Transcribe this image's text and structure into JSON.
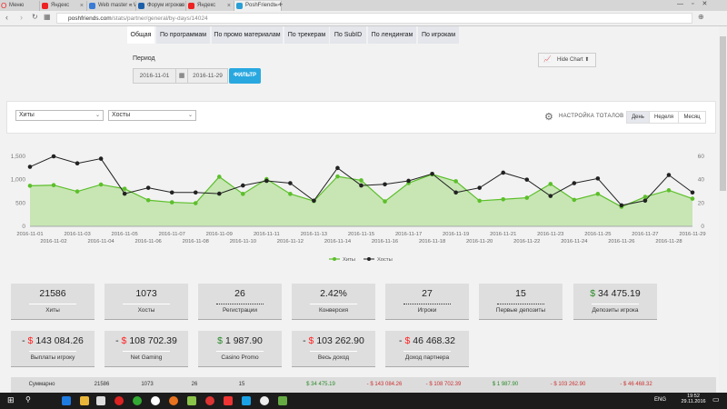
{
  "browser": {
    "menu": "Меню",
    "tabs": [
      {
        "title": "Яндекс",
        "color": "#e22"
      },
      {
        "title": "Web master « Web master",
        "color": "#3a7bd5"
      },
      {
        "title": "Форум игроков онлайн-к",
        "color": "#1c5fa8"
      },
      {
        "title": "Яндекс",
        "color": "#e22"
      },
      {
        "title": "PoshFriends - Партнерск",
        "color": "#2a9fd6"
      }
    ],
    "url_domain": "poshfriends.com",
    "url_path": "/stats/partner/general/by-days/14024"
  },
  "nav": {
    "tabs": [
      "Общая",
      "По программам",
      "По промо материалам",
      "По трекерам",
      "По SubID",
      "По лендингам",
      "По игрокам"
    ],
    "active": 0
  },
  "period": {
    "label": "Период",
    "from": "2016-11-01",
    "to": "2016-11-29",
    "filter": "ФИЛЬТР"
  },
  "hide_chart": "Hide Chart",
  "selects": {
    "left": "Хиты",
    "right": "Хосты"
  },
  "totals_settings": "НАСТРОЙКА ТОТАЛОВ",
  "periods": [
    "День",
    "Неделя",
    "Месяц"
  ],
  "chart_data": {
    "type": "line",
    "x": [
      "2016-11-01",
      "2016-11-02",
      "2016-11-03",
      "2016-11-04",
      "2016-11-05",
      "2016-11-06",
      "2016-11-07",
      "2016-11-08",
      "2016-11-09",
      "2016-11-10",
      "2016-11-11",
      "2016-11-12",
      "2016-11-13",
      "2016-11-14",
      "2016-11-15",
      "2016-11-16",
      "2016-11-17",
      "2016-11-18",
      "2016-11-19",
      "2016-11-20",
      "2016-11-21",
      "2016-11-22",
      "2016-11-23",
      "2016-11-24",
      "2016-11-25",
      "2016-11-26",
      "2016-11-27",
      "2016-11-28",
      "2016-11-29"
    ],
    "series": [
      {
        "name": "Хиты",
        "axis": "left",
        "type": "area",
        "color": "#5cbf2a",
        "values": [
          869,
          882,
          747,
          895,
          805,
          560,
          515,
          496,
          1062,
          695,
          1011,
          695,
          541,
          1069,
          985,
          534,
          927,
          1114,
          966,
          547,
          579,
          612,
          908,
          567,
          695,
          418,
          631,
          773,
          592
        ]
      },
      {
        "name": "Хосты",
        "axis": "right",
        "type": "line",
        "color": "#222222",
        "values": [
          51,
          60,
          54,
          58,
          28,
          33,
          29,
          29,
          28,
          35,
          39,
          37,
          22,
          50,
          35,
          36,
          39,
          45,
          29,
          33,
          46,
          40,
          26,
          37,
          41,
          18,
          22,
          44,
          29
        ]
      }
    ],
    "yleft": {
      "range": [
        0,
        1500
      ],
      "ticks": [
        "0",
        "500",
        "1,000",
        "1,500"
      ]
    },
    "yright": {
      "range": [
        0,
        60
      ],
      "ticks": [
        "0",
        "20",
        "40",
        "60"
      ]
    },
    "legend": "bottom-center"
  },
  "cards": [
    {
      "value": "21586",
      "label": "Хиты",
      "line": "solid"
    },
    {
      "value": "1073",
      "label": "Хосты",
      "line": "solid"
    },
    {
      "value": "26",
      "label": "Регистрации",
      "line": "dotted"
    },
    {
      "value": "2.42%",
      "label": "Конверсия",
      "line": "solid"
    },
    {
      "value": "27",
      "label": "Игроки",
      "line": "dotted"
    },
    {
      "value": "15",
      "label": "Первые депозиты",
      "line": "dotted"
    },
    {
      "sign": "",
      "cur": "$",
      "amount": "34 475.19",
      "label": "Депозиты игрока",
      "positive": true
    },
    {
      "sign": "- ",
      "cur": "$",
      "amount": "143 084.26",
      "label": "Выплаты игроку",
      "positive": false
    },
    {
      "sign": "- ",
      "cur": "$",
      "amount": "108 702.39",
      "label": "Net Gaming",
      "positive": false
    },
    {
      "sign": "",
      "cur": "$",
      "amount": "1 987.90",
      "label": "Casino Promo",
      "positive": true
    },
    {
      "sign": "- ",
      "cur": "$",
      "amount": "103 262.90",
      "label": "Весь доход",
      "positive": false
    },
    {
      "sign": "- ",
      "cur": "$",
      "amount": "46 468.32",
      "label": "Доход партнера",
      "positive": false
    }
  ],
  "summary": [
    "Суммарно",
    "21586",
    "1073",
    "26",
    "15",
    "$ 34 475.19",
    "- $ 143 084.26",
    "- $ 108 702.39",
    "$ 1 987.90",
    "- $ 103 262.90",
    "- $ 46 468.32"
  ],
  "taskbar": {
    "lang": "ENG",
    "time": "19:52",
    "date": "29.11.2016"
  }
}
